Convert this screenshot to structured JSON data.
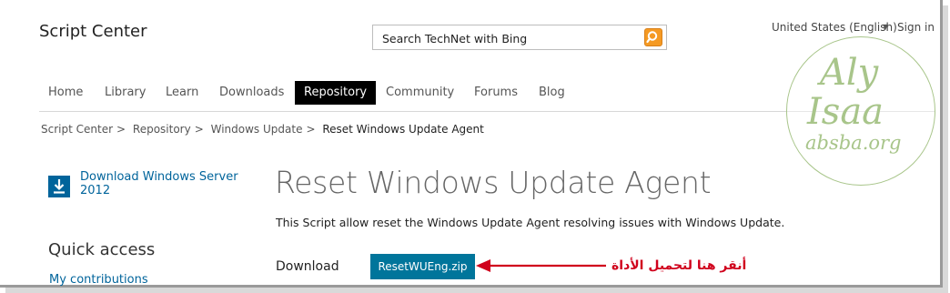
{
  "header": {
    "brand": "Script Center",
    "search_placeholder": "Search TechNet with Bing",
    "locale": "United States (English)",
    "signin": "Sign in"
  },
  "nav": {
    "items": [
      {
        "label": "Home"
      },
      {
        "label": "Library"
      },
      {
        "label": "Learn"
      },
      {
        "label": "Downloads"
      },
      {
        "label": "Repository",
        "active": true
      },
      {
        "label": "Community"
      },
      {
        "label": "Forums"
      },
      {
        "label": "Blog"
      }
    ]
  },
  "breadcrumb": {
    "items": [
      "Script Center",
      "Repository",
      "Windows Update"
    ],
    "separator": ">",
    "current": "Reset Windows Update Agent"
  },
  "sidebar": {
    "download_link": "Download Windows Server 2012",
    "quick_access_title": "Quick access",
    "my_contributions": "My contributions"
  },
  "main": {
    "title": "Reset Windows Update Agent",
    "description": "This Script allow reset the Windows Update Agent resolving issues with Windows Update.",
    "download_label": "Download",
    "download_button": "ResetWUEng.zip"
  },
  "annotation": {
    "text": "أنقر هنا لتحميل الأداة",
    "color": "#d0001c"
  },
  "watermark": {
    "line1": "Aly",
    "line2": "Isaa",
    "line3": "absba.org",
    "color": "#a8c58a"
  },
  "colors": {
    "accent": "#00649b",
    "nav_active_bg": "#000000",
    "search_button": "#f59a23"
  }
}
